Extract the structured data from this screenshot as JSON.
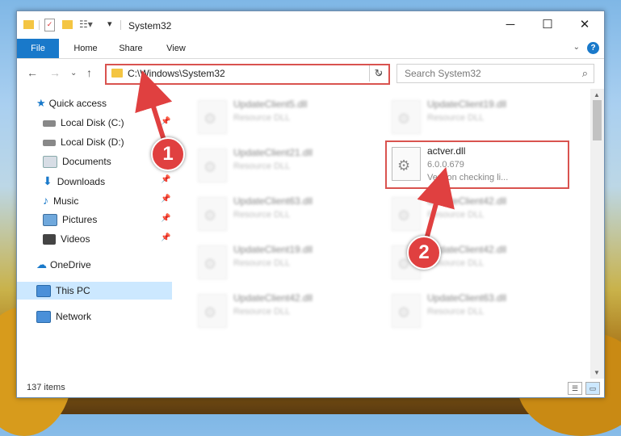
{
  "window": {
    "title": "System32",
    "controls": {
      "minimize": "─",
      "maximize": "☐",
      "close": "✕"
    }
  },
  "ribbon": {
    "tabs": [
      "File",
      "Home",
      "Share",
      "View"
    ],
    "help": "?"
  },
  "address": {
    "path": "C:\\Windows\\System32"
  },
  "search": {
    "placeholder": "Search System32"
  },
  "sidebar": {
    "items": [
      {
        "label": "Quick access",
        "icon": "star-icon"
      },
      {
        "label": "Local Disk (C:)",
        "icon": "drive-icon"
      },
      {
        "label": "Local Disk (D:)",
        "icon": "drive-icon"
      },
      {
        "label": "Documents",
        "icon": "documents-icon"
      },
      {
        "label": "Downloads",
        "icon": "download-icon"
      },
      {
        "label": "Music",
        "icon": "music-icon"
      },
      {
        "label": "Pictures",
        "icon": "pictures-icon"
      },
      {
        "label": "Videos",
        "icon": "videos-icon"
      },
      {
        "label": "OneDrive",
        "icon": "cloud-icon"
      },
      {
        "label": "This PC",
        "icon": "computer-icon",
        "selected": true
      },
      {
        "label": "Network",
        "icon": "network-icon"
      }
    ]
  },
  "files": [
    {
      "name": "UpdateClient5.dll",
      "type": "Resource DLL"
    },
    {
      "name": "UpdateClient19.dll",
      "type": "Resource DLL"
    },
    {
      "name": "UpdateClient21.dll",
      "type": "Resource DLL"
    },
    {
      "name": "actver.dll",
      "type": "6.0.0.679",
      "desc": "Version checking li..."
    },
    {
      "name": "UpdateClient63.dll",
      "type": "Resource DLL"
    },
    {
      "name": "UpdateClient42.dll",
      "type": "Resource DLL"
    },
    {
      "name": "UpdateClient19.dll",
      "type": "Resource DLL"
    },
    {
      "name": "UpdateClient42.dll",
      "type": "Resource DLL"
    },
    {
      "name": "UpdateClient42.dll",
      "type": "Resource DLL"
    },
    {
      "name": "UpdateClient63.dll",
      "type": "Resource DLL"
    }
  ],
  "status": {
    "item_count": "137 items"
  },
  "callouts": {
    "one": "1",
    "two": "2"
  },
  "colors": {
    "accent": "#1979ca",
    "highlight": "#d9534f",
    "selection": "#cce8ff"
  }
}
